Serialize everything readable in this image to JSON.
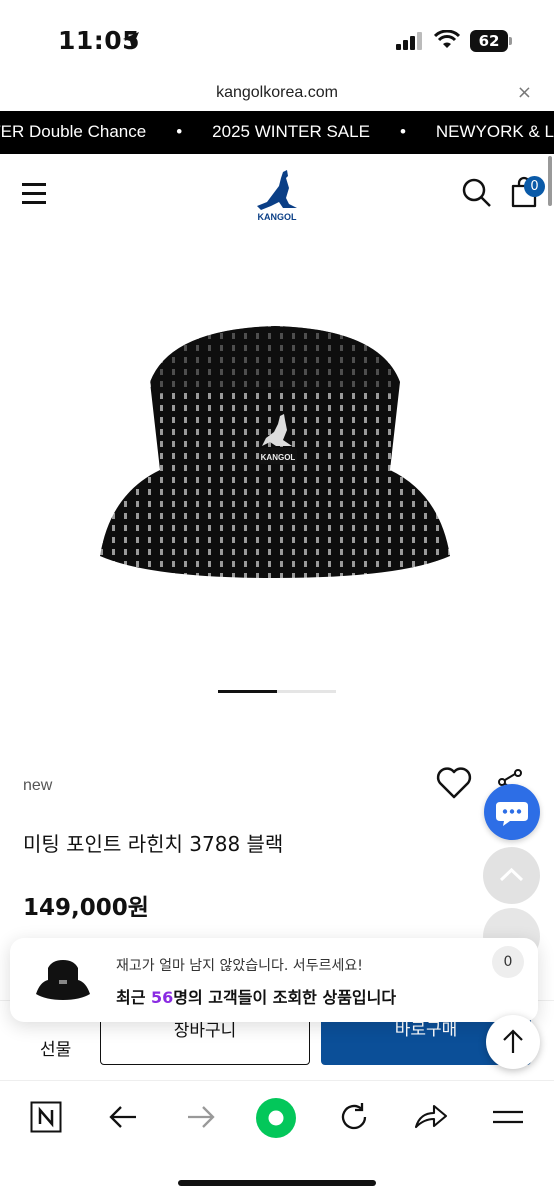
{
  "status_bar": {
    "time": "11:05",
    "battery": "62"
  },
  "browser": {
    "url": "kangolkorea.com",
    "close_label": "×"
  },
  "marquee": {
    "items": [
      "NTER Double Chance",
      "2025 WINTER SALE",
      "NEWYORK & L"
    ],
    "separator": "•"
  },
  "header": {
    "logo_text": "KANGOL",
    "cart_count": "0"
  },
  "product": {
    "badge": "new",
    "title": "미팅 포인트 라힌치 3788 블랙",
    "price": "149,000원",
    "slider": {
      "current": 1,
      "total": 2
    }
  },
  "buy_bar": {
    "gift_label": "선물",
    "cart_label": "장바구니",
    "buy_label": "바로구매"
  },
  "toast": {
    "line1": "재고가 얼마 남지 않았습니다. 서두르세요!",
    "line2_prefix": "최근 ",
    "line2_number": "56",
    "line2_suffix": "명의 고객들이 조회한 상품입니다",
    "count": "0"
  },
  "colors": {
    "brand_blue": "#0b4f98",
    "chat_blue": "#2d6ee6",
    "accent_purple": "#8a2be2",
    "naver_green": "#03c75a"
  }
}
